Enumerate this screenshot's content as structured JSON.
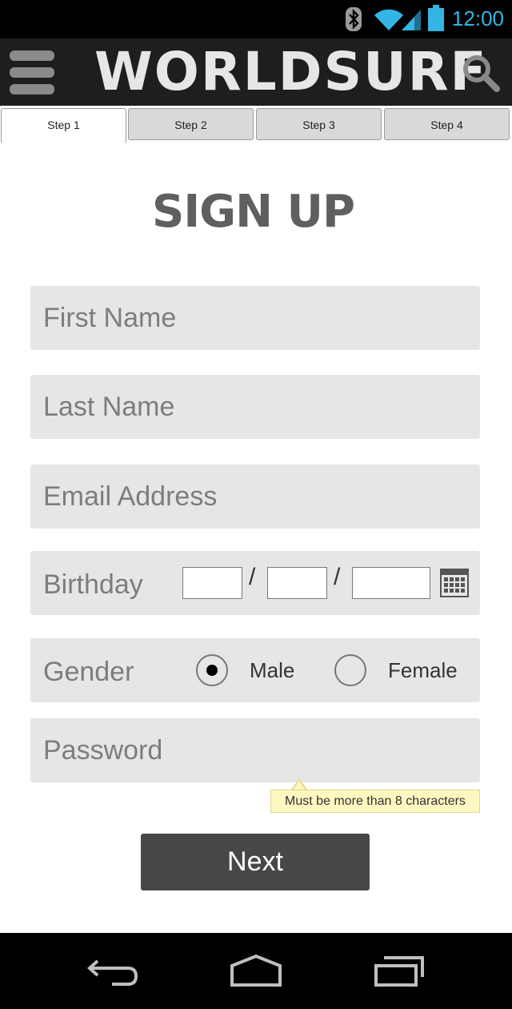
{
  "status_bar": {
    "time": "12:00",
    "icons": [
      "bluetooth-icon",
      "wifi-icon",
      "cell-signal-icon",
      "battery-icon"
    ],
    "accent_color": "#33b5e5"
  },
  "app_bar": {
    "logo_text": "WORLDSURF",
    "menu_icon": "menu-icon",
    "search_icon": "search-icon"
  },
  "tabs": [
    {
      "label": "Step 1",
      "active": true
    },
    {
      "label": "Step 2",
      "active": false
    },
    {
      "label": "Step 3",
      "active": false
    },
    {
      "label": "Step 4",
      "active": false
    }
  ],
  "page_title": "SIGN UP",
  "form": {
    "first_name": {
      "placeholder": "First Name",
      "value": ""
    },
    "last_name": {
      "placeholder": "Last Name",
      "value": ""
    },
    "email": {
      "placeholder": "Email Address",
      "value": ""
    },
    "birthday": {
      "label": "Birthday",
      "separator": "/",
      "month": "",
      "day": "",
      "year": "",
      "calendar_icon": "calendar-icon"
    },
    "gender": {
      "label": "Gender",
      "options": [
        {
          "label": "Male",
          "selected": true
        },
        {
          "label": "Female",
          "selected": false
        }
      ]
    },
    "password": {
      "placeholder": "Password",
      "value": "",
      "hint": "Must be more than 8 characters"
    },
    "next_label": "Next"
  },
  "nav_bar": {
    "buttons": [
      "back-icon",
      "home-icon",
      "recent-apps-icon"
    ]
  }
}
